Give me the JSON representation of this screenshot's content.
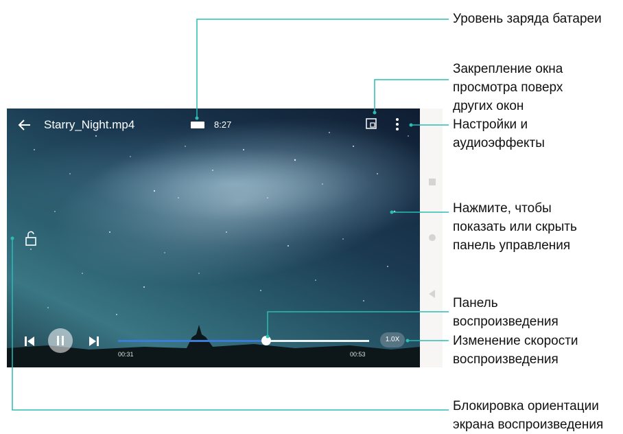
{
  "video": {
    "title": "Starry_Night.mp4",
    "time": "8:27",
    "elapsed": "00:31",
    "duration": "00:53",
    "progress": 0.59,
    "speed": "1.0X"
  },
  "icons": {
    "back": "back-arrow-icon",
    "battery": "battery-icon",
    "pin": "pip-window-icon",
    "menu": "more-vertical-icon",
    "lock": "unlock-orientation-icon",
    "prev": "skip-previous-icon",
    "pause": "pause-icon",
    "next": "skip-next-icon"
  },
  "callouts": {
    "battery_level": "Уровень заряда батареи",
    "pin_window": "Закрепление окна\nпросмотра поверх\nдругих окон",
    "settings": "Настройки и\nаудиоэффекты",
    "toggle_panel": "Нажмите, чтобы\nпоказать или скрыть\nпанель управления",
    "playback_bar": "Панель\nвоспроизведения",
    "speed_change": "Изменение скорости\nвоспроизведения",
    "orientation_lock": "Блокировка ориентации\nэкрана воспроизведения"
  },
  "colors": {
    "callout_line": "#2bbcb4",
    "progress": "#3c7bd6"
  }
}
